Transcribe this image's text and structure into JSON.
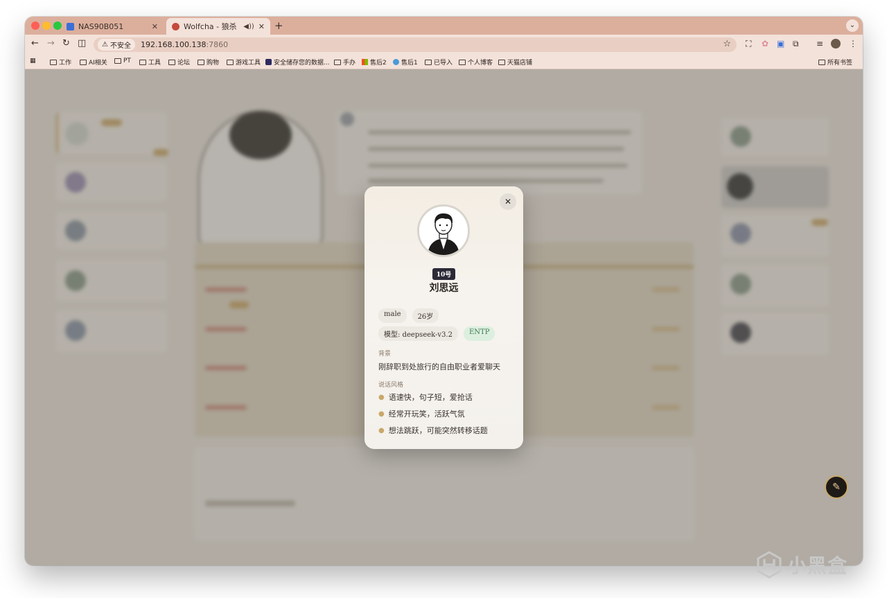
{
  "browser": {
    "tabs": [
      {
        "title": "NAS90B051",
        "favicon_color": "#3b6fd8"
      },
      {
        "title": "Wolfcha - 狼杀",
        "favicon_color": "#c44a3a"
      }
    ],
    "url_security_label": "不安全",
    "url_host": "192.168.100.138",
    "url_port": ":7860",
    "bookmarks": [
      "工作",
      "AI相关",
      "PT",
      "工具",
      "论坛",
      "购物",
      "游戏工具",
      "安全储存您的数据...",
      "手办",
      "售后2",
      "售后1",
      "已导入",
      "个人博客",
      "天猫店铺"
    ],
    "all_bookmarks_label": "所有书签"
  },
  "modal": {
    "seat_label": "10号",
    "player_name": "刘思远",
    "tags_row1": [
      "male",
      "26岁"
    ],
    "model_tag": "模型: deepseek-v3.2",
    "mbti": "ENTP",
    "background_label": "背景",
    "background_text": "刚辞职到处旅行的自由职业者爱聊天",
    "speech_style_label": "说话风格",
    "speech_style": [
      "语速快，句子短，爱抢话",
      "经常开玩笑，活跃气氛",
      "想法跳跃，可能突然转移话题"
    ]
  },
  "icons": {
    "close": "close-icon",
    "edit": "edit-icon",
    "star": "bookmark-star-icon"
  },
  "watermark": {
    "text": "小黑盒"
  }
}
